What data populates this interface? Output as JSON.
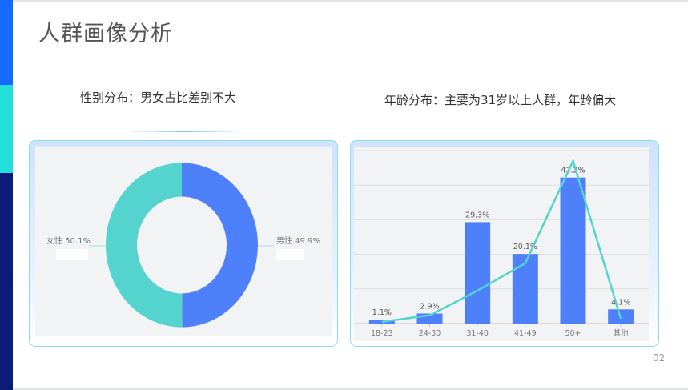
{
  "title": "人群画像分析",
  "gender_subtitle": "性别分布：男女占比差别不大",
  "age_subtitle": "年龄分布：主要为31岁以上人群，年龄偏大",
  "page_number": "02",
  "colors": {
    "blue": "#4f80fc",
    "teal": "#55d3cf",
    "side_blue": "#1769ff",
    "side_cyan": "#23e0dc",
    "side_navy": "#0c1a78"
  },
  "chart_data": [
    {
      "type": "pie",
      "donut": true,
      "slices": [
        {
          "label": "女性",
          "value": 50.1,
          "text": "女性 50.1%"
        },
        {
          "label": "男性",
          "value": 49.9,
          "text": "男性 49.9%"
        }
      ]
    },
    {
      "type": "bar",
      "categories": [
        "18-23",
        "24-30",
        "31-40",
        "41-49",
        "50+",
        "其他"
      ],
      "values": [
        1.1,
        2.9,
        29.3,
        20.1,
        42.2,
        4.1
      ],
      "labels": [
        "1.1%",
        "2.9%",
        "29.3%",
        "20.1%",
        "42.2%",
        "4.1%"
      ],
      "line_values": [
        0.5,
        2.4,
        9.5,
        17.4,
        47,
        1.4
      ],
      "ylim": [
        0,
        50
      ],
      "grid": true
    }
  ]
}
